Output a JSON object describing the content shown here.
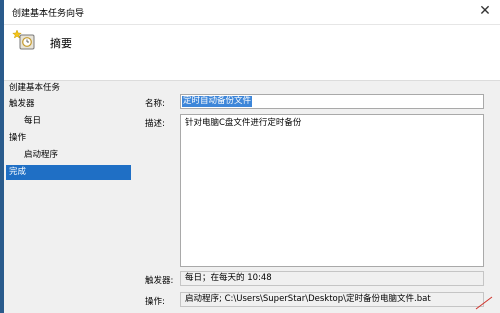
{
  "window": {
    "title": "创建基本任务向导",
    "close_glyph": "✕"
  },
  "header": {
    "title": "摘要",
    "icon": "wizard-clock-icon"
  },
  "steps": [
    {
      "label": "创建基本任务",
      "level": 1,
      "active": false
    },
    {
      "label": "触发器",
      "level": 1,
      "active": false
    },
    {
      "label": "每日",
      "level": 2,
      "active": false
    },
    {
      "label": "操作",
      "level": 1,
      "active": false
    },
    {
      "label": "启动程序",
      "level": 2,
      "active": false
    },
    {
      "label": "完成",
      "level": 1,
      "active": true
    }
  ],
  "form": {
    "name_label": "名称:",
    "name_value": "定时自动备份文件",
    "desc_label": "描述:",
    "desc_value": "针对电脑C盘文件进行定时备份",
    "trigger_label": "触发器:",
    "trigger_value": "每日；在每天的 10:48",
    "action_label": "操作:",
    "action_value": "启动程序; C:\\Users\\SuperStar\\Desktop\\定时备份电脑文件.bat"
  },
  "colors": {
    "selection": "#1f6fc5",
    "panel_bg": "#f0f0f0",
    "window_edge": "#2a5b8c"
  }
}
